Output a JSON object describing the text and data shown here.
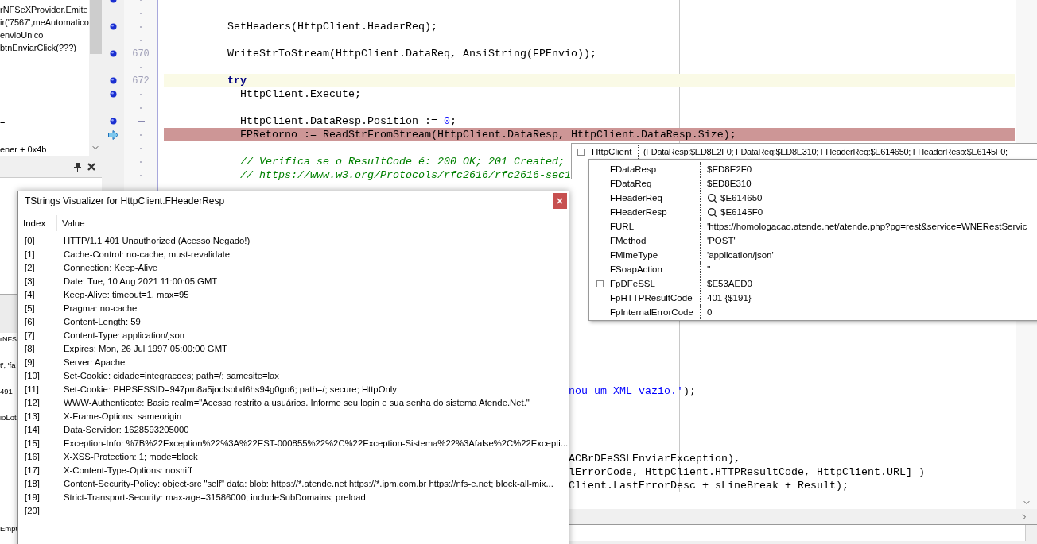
{
  "left_panel": {
    "stack_items": [
      "rNFSeXProvider.Emite",
      "ir('7567',meAutomatico",
      "envioUnico",
      "btnEnviarClick(???)",
      "=",
      "ener + 0x4b"
    ],
    "lower_tab": "rNFS",
    "lower_texts": [
      "t', 'fa",
      "491-",
      "ioLot"
    ],
    "status_text": "Empt"
  },
  "editor": {
    "lines": [
      {
        "breakpoint": true,
        "fold": false,
        "current": false,
        "execution": false
      },
      {
        "breakpoint": false,
        "fold": false,
        "current": false,
        "execution": false
      },
      {
        "breakpoint": true,
        "fold": false,
        "current": false,
        "execution": false,
        "tokens": [
          {
            "kind": "plain",
            "text": "SetHeaders(HttpClient.HeaderReq);"
          }
        ]
      },
      {
        "breakpoint": false,
        "fold": false,
        "current": false,
        "execution": false
      },
      {
        "breakpoint": true,
        "number": "670",
        "current": false,
        "execution": false,
        "tokens": [
          {
            "kind": "plain",
            "text": "WriteStrToStream(HttpClient.DataReq, AnsiString(FPEnvio));"
          }
        ]
      },
      {
        "breakpoint": false,
        "fold": false,
        "current": false,
        "execution": false
      },
      {
        "breakpoint": true,
        "number": "672",
        "current": true,
        "execution": false,
        "tokens": [
          {
            "kind": "keyword",
            "text": "try"
          }
        ]
      },
      {
        "breakpoint": true,
        "fold": false,
        "current": false,
        "execution": false,
        "tokens": [
          {
            "kind": "plain",
            "text": "  HttpClient.Execute;"
          }
        ]
      },
      {
        "breakpoint": false,
        "fold": false,
        "current": false,
        "execution": false
      },
      {
        "breakpoint": true,
        "fold": true,
        "current": false,
        "execution": false,
        "tokens": [
          {
            "kind": "plain",
            "text": "  HttpClient.DataResp.Position := "
          },
          {
            "kind": "number",
            "text": "0"
          },
          {
            "kind": "plain",
            "text": ";"
          }
        ]
      },
      {
        "breakpoint": false,
        "fold": false,
        "current": false,
        "execution": true,
        "tokens": [
          {
            "kind": "plain",
            "text": "  FPRetorno := ReadStrFromStream(HttpClient.DataResp, HttpClient.DataResp.Size);"
          }
        ]
      },
      {
        "breakpoint": false,
        "fold": false,
        "current": false,
        "execution": false
      },
      {
        "breakpoint": false,
        "fold": false,
        "current": false,
        "execution": false,
        "tokens": [
          {
            "kind": "comment",
            "text": "  // Verifica se o ResultCode é: 200 OK; 201 Created;"
          }
        ]
      },
      {
        "breakpoint": false,
        "fold": false,
        "current": false,
        "execution": false,
        "tokens": [
          {
            "kind": "comment",
            "text": "  // https://www.w3.org/Protocols/rfc2616/rfc2616-sec1"
          }
        ]
      }
    ],
    "lower_lines": [
      {
        "tokens": [
          {
            "kind": "string",
            "text": "nou um XML vazio.'"
          },
          {
            "kind": "plain",
            "text": ");"
          }
        ]
      },
      {
        "tokens": [
          {
            "kind": "plain",
            "text": "ACBrDFeSSLEnviarException),"
          }
        ]
      },
      {
        "tokens": [
          {
            "kind": "plain",
            "text": "lErrorCode, HttpClient.HTTPResultCode, HttpClient.URL] )"
          }
        ]
      },
      {
        "tokens": [
          {
            "kind": "plain",
            "text": "Client.LastErrorDesc + sLineBreak + Result);"
          }
        ]
      }
    ]
  },
  "visualizer": {
    "title": "TStrings Visualizer for HttpClient.FHeaderResp",
    "columns": [
      "Index",
      "Value"
    ],
    "rows": [
      {
        "index": "[0]",
        "value": "HTTP/1.1 401 Unauthorized (Acesso Negado!)"
      },
      {
        "index": "[1]",
        "value": "Cache-Control: no-cache, must-revalidate"
      },
      {
        "index": "[2]",
        "value": "Connection: Keep-Alive"
      },
      {
        "index": "[3]",
        "value": "Date: Tue, 10 Aug 2021 11:00:05 GMT"
      },
      {
        "index": "[4]",
        "value": "Keep-Alive: timeout=1, max=95"
      },
      {
        "index": "[5]",
        "value": "Pragma: no-cache"
      },
      {
        "index": "[6]",
        "value": "Content-Length: 59"
      },
      {
        "index": "[7]",
        "value": "Content-Type: application/json"
      },
      {
        "index": "[8]",
        "value": "Expires: Mon, 26 Jul 1997 05:00:00 GMT"
      },
      {
        "index": "[9]",
        "value": "Server: Apache"
      },
      {
        "index": "[10]",
        "value": "Set-Cookie: cidade=integracoes; path=/; samesite=lax"
      },
      {
        "index": "[11]",
        "value": "Set-Cookie: PHPSESSID=947pm8a5joclsobd6hs94g0go6; path=/; secure; HttpOnly"
      },
      {
        "index": "[12]",
        "value": "WWW-Authenticate: Basic realm=\"Acesso restrito a usuários. Informe seu login e sua senha do sistema Atende.Net.\""
      },
      {
        "index": "[13]",
        "value": "X-Frame-Options: sameorigin"
      },
      {
        "index": "[14]",
        "value": "Data-Servidor: 1628593205000"
      },
      {
        "index": "[15]",
        "value": "Exception-Info: %7B%22Exception%22%3A%22EST-000855%22%2C%22Exception-Sistema%22%3Afalse%2C%22Excepti..."
      },
      {
        "index": "[16]",
        "value": "X-XSS-Protection: 1; mode=block"
      },
      {
        "index": "[17]",
        "value": "X-Content-Type-Options: nosniff"
      },
      {
        "index": "[18]",
        "value": "Content-Security-Policy: object-src \"self\" data: blob: https://*.atende.net https://*.ipm.com.br https://nfs-e.net; block-all-mix..."
      },
      {
        "index": "[19]",
        "value": "Strict-Transport-Security: max-age=31586000; includeSubDomains; preload"
      },
      {
        "index": "[20]"
      }
    ]
  },
  "inspector": {
    "name": "HttpClient",
    "expanded": true,
    "summary": "(FDataResp:$ED8E2F0; FDataReq:$ED8E310; FHeaderReq:$E614650; FHeaderResp:$E6145F0;",
    "fields": [
      {
        "kind": "plain",
        "name": "FDataResp",
        "value": "$ED8E2F0"
      },
      {
        "kind": "plain",
        "name": "FDataReq",
        "value": "$ED8E310"
      },
      {
        "kind": "object",
        "name": "FHeaderReq",
        "value": "$E614650"
      },
      {
        "kind": "object",
        "name": "FHeaderResp",
        "value": "$E6145F0"
      },
      {
        "kind": "plain",
        "name": "FURL",
        "value": "'https://homologacao.atende.net/atende.php?pg=rest&service=WNERestServic"
      },
      {
        "kind": "plain",
        "name": "FMethod",
        "value": "'POST'"
      },
      {
        "kind": "plain",
        "name": "FMimeType",
        "value": "'application/json'"
      },
      {
        "kind": "plain",
        "name": "FSoapAction",
        "value": "''"
      },
      {
        "kind": "expandable",
        "name": "FpDFeSSL",
        "value": "$E53AED0"
      },
      {
        "kind": "plain",
        "name": "FpHTTPResultCode",
        "value": "401 {$191}"
      },
      {
        "kind": "plain",
        "name": "FpInternalErrorCode",
        "value": "0"
      }
    ]
  }
}
